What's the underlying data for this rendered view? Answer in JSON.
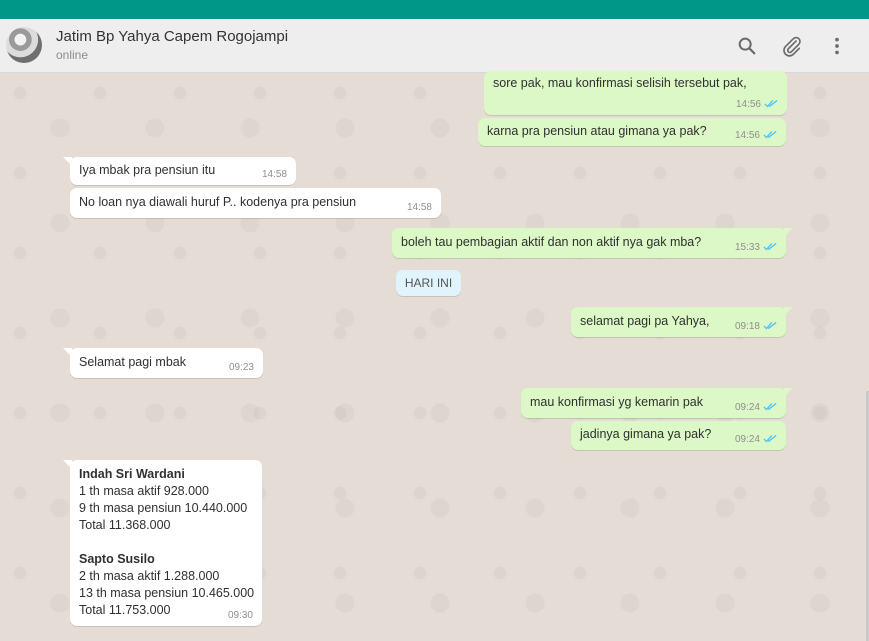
{
  "header": {
    "contact_name": "Jatim Bp Yahya Capem Rogojampi",
    "status": "online",
    "icons": [
      "search-icon",
      "attach-icon",
      "menu-icon"
    ]
  },
  "colors": {
    "topbar": "#009688",
    "outgoing_bubble": "#dcf8c6",
    "incoming_bubble": "#ffffff",
    "read_ticks": "#4fc3f7"
  },
  "day_divider": "HARI INI",
  "messages": [
    {
      "dir": "out",
      "text": "sore pak, mau konfirmasi selisih tersebut pak,",
      "time": "14:56",
      "read": true
    },
    {
      "dir": "out",
      "text": "karna pra pensiun atau gimana ya pak?",
      "time": "14:56",
      "read": true
    },
    {
      "dir": "in",
      "text": "Iya mbak pra pensiun itu",
      "time": "14:58"
    },
    {
      "dir": "in",
      "text": "No loan nya diawali huruf P.. kodenya pra pensiun",
      "time": "14:58"
    },
    {
      "dir": "out",
      "text": "boleh tau pembagian aktif dan non aktif nya gak mba?",
      "time": "15:33",
      "read": true
    },
    {
      "dir": "out",
      "text": "selamat pagi pa Yahya,",
      "time": "09:18",
      "read": true
    },
    {
      "dir": "in",
      "text": "Selamat pagi mbak",
      "time": "09:23"
    },
    {
      "dir": "out",
      "text": "mau konfirmasi yg kemarin pak",
      "time": "09:24",
      "read": true
    },
    {
      "dir": "out",
      "text": "jadinya gimana ya pak?",
      "time": "09:24",
      "read": true
    },
    {
      "dir": "in",
      "time": "09:30",
      "lines": [
        "Indah Sri Wardani",
        "1 th masa aktif 928.000",
        "9 th masa pensiun 10.440.000",
        "Total 11.368.000",
        "",
        "Sapto Susilo",
        "2 th masa aktif 1.288.000",
        "13 th masa pensiun 10.465.000",
        "Total 11.753.000"
      ]
    }
  ]
}
